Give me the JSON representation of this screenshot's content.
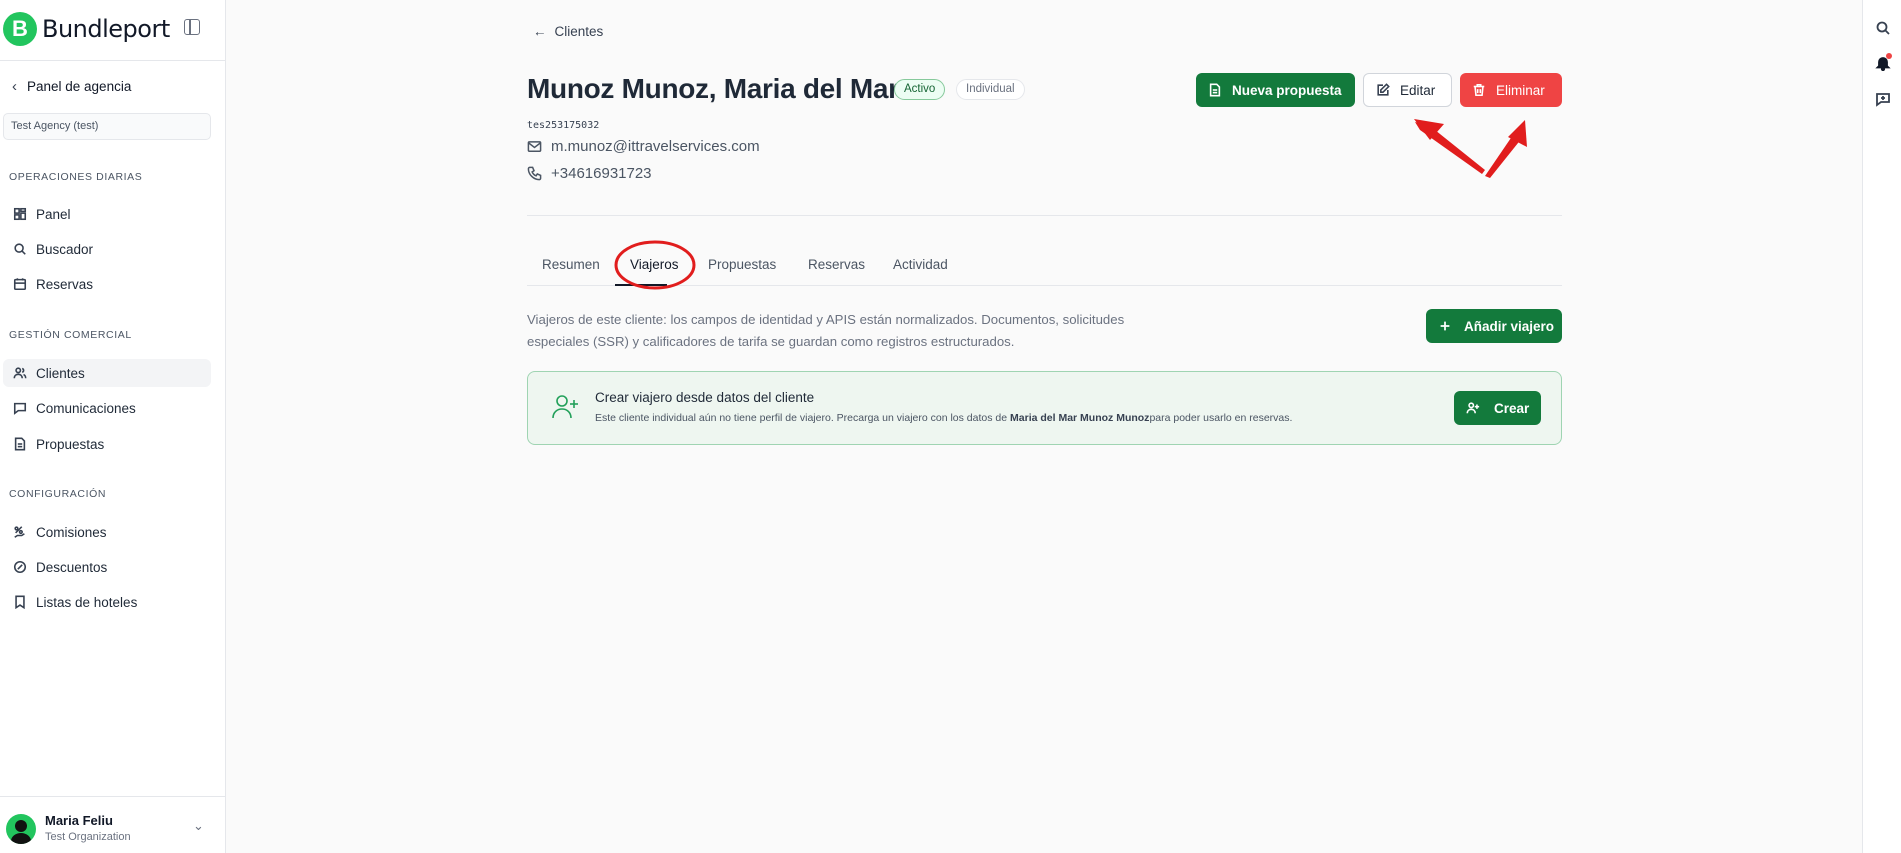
{
  "sidebar": {
    "brand_initial": "B",
    "brand_name": "Bundleport",
    "back_label": "Panel de agencia",
    "agency": "Test Agency (test)",
    "sections": [
      {
        "title": "OPERACIONES DIARIAS",
        "items": [
          {
            "label": "Panel",
            "icon": "dashboard-icon"
          },
          {
            "label": "Buscador",
            "icon": "search-icon"
          },
          {
            "label": "Reservas",
            "icon": "calendar-icon"
          }
        ]
      },
      {
        "title": "GESTIÓN COMERCIAL",
        "items": [
          {
            "label": "Clientes",
            "icon": "users-icon"
          },
          {
            "label": "Comunicaciones",
            "icon": "message-icon"
          },
          {
            "label": "Propuestas",
            "icon": "document-icon"
          }
        ]
      },
      {
        "title": "CONFIGURACIÓN",
        "items": [
          {
            "label": "Comisiones",
            "icon": "percent-hand-icon"
          },
          {
            "label": "Descuentos",
            "icon": "discount-icon"
          },
          {
            "label": "Listas de hoteles",
            "icon": "bookmark-icon"
          }
        ]
      }
    ],
    "active_item": "Clientes",
    "user": {
      "name": "Maria Feliu",
      "org": "Test Organization"
    }
  },
  "main": {
    "back_link": "Clientes",
    "client_name": "Munoz Munoz, Maria del Mar",
    "status_badge": "Activo",
    "type_badge": "Individual",
    "client_code": "tes253175032",
    "email": "m.munoz@ittravelservices.com",
    "phone": "+34616931723",
    "actions": {
      "new_proposal": "Nueva propuesta",
      "edit": "Editar",
      "delete": "Eliminar"
    },
    "tabs": [
      "Resumen",
      "Viajeros",
      "Propuestas",
      "Reservas",
      "Actividad"
    ],
    "active_tab": "Viajeros",
    "description": "Viajeros de este cliente: los campos de identidad y APIS están normalizados. Documentos, solicitudes especiales (SSR) y calificadores de tarifa se guardan como registros estructurados.",
    "add_traveler": "Añadir viajero",
    "card": {
      "title": "Crear viajero desde datos del cliente",
      "text_before": "Este cliente individual aún no tiene perfil de viajero. Precarga un viajero con los datos de ",
      "text_name": "Maria del Mar Munoz Munoz",
      "text_after": "para poder usarlo en reservas.",
      "button": "Crear"
    }
  },
  "colors": {
    "brand_green": "#137a3c",
    "logo_green": "#22c55e",
    "danger": "#ef4444",
    "annotation_red": "#e11d1d"
  }
}
